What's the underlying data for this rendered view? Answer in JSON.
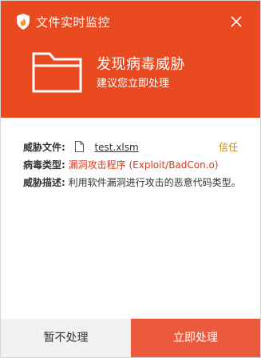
{
  "window": {
    "title": "文件实时监控",
    "accent_color": "#e94a1f"
  },
  "alert": {
    "headline": "发现病毒威胁",
    "subhead": "建议您立即处理",
    "icon": "folder-icon"
  },
  "details": {
    "file_label": "威胁文件:",
    "file_name": "test.xlsm",
    "trust_label": "信任",
    "virus_type_label": "病毒类型:",
    "virus_type_value": "漏洞攻击程序 (Exploit/BadCon.o)",
    "description_label": "威胁描述:",
    "description_value": "利用软件漏洞进行攻击的恶意代码类型。"
  },
  "footer": {
    "later_label": "暂不处理",
    "now_label": "立即处理",
    "now_color": "#ec5a3e"
  }
}
